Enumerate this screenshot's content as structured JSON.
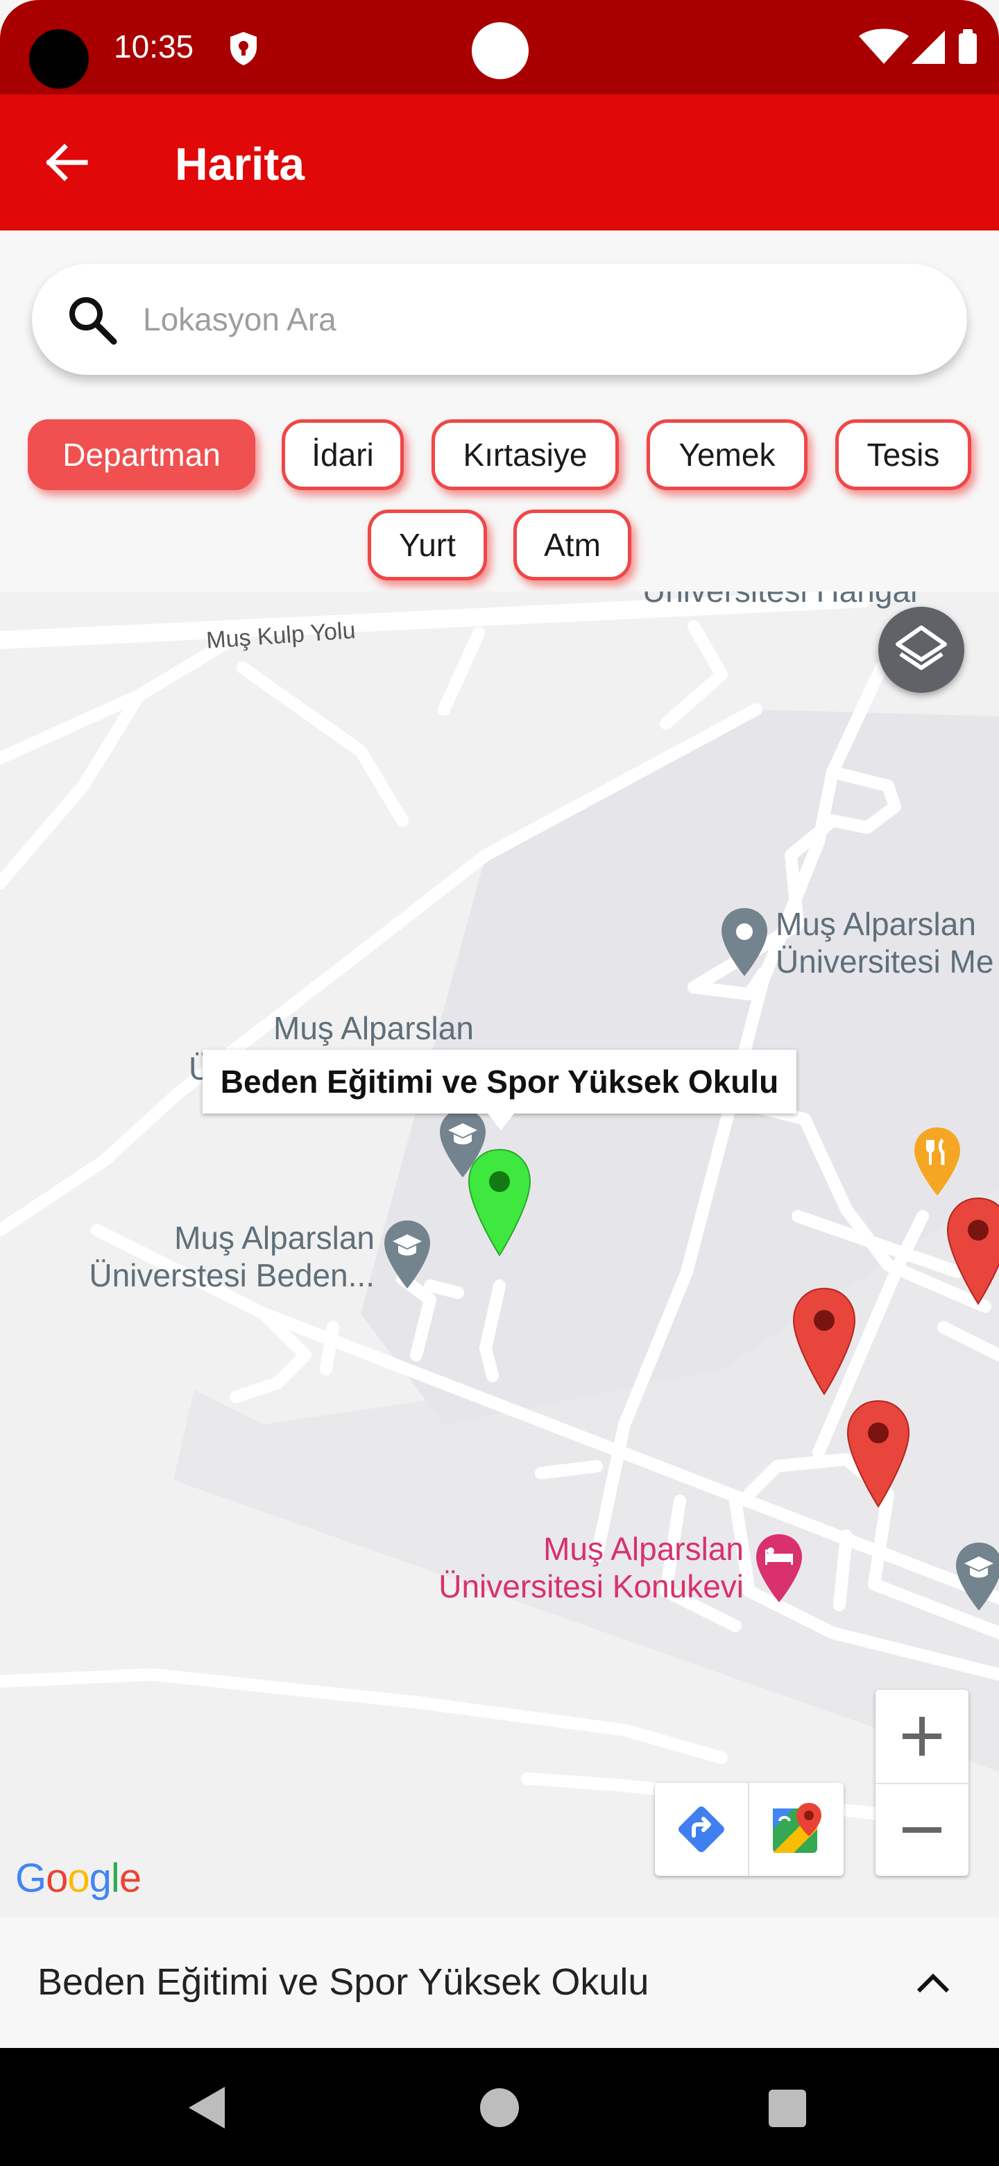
{
  "status_bar": {
    "time": "10:35"
  },
  "app_bar": {
    "title": "Harita"
  },
  "search": {
    "placeholder": "Lokasyon Ara",
    "value": ""
  },
  "filters": [
    {
      "label": "Departman",
      "selected": true
    },
    {
      "label": "İdari",
      "selected": false
    },
    {
      "label": "Kırtasiye",
      "selected": false
    },
    {
      "label": "Yemek",
      "selected": false
    },
    {
      "label": "Tesis",
      "selected": false
    },
    {
      "label": "Yurt",
      "selected": false
    },
    {
      "label": "Atm",
      "selected": false
    }
  ],
  "map": {
    "road_label": "Muş Kulp Yolu",
    "labels": {
      "hangar": "Üniversitesi Hangar",
      "med_line1": "Muş Alparslan",
      "med_line2": "Üniversitesi Me",
      "alparslan_top": "Muş Alparslan",
      "alparslan_partial": "Ü",
      "beden_line1": "Muş Alparslan",
      "beden_line2": "Üniverstesi Beden...",
      "konukevi_line1": "Muş Alparslan",
      "konukevi_line2": "Üniversitesi Konukevi"
    },
    "info_window": "Beden Eğitimi ve Spor Yüksek Okulu",
    "google_logo": "Google"
  },
  "bottom_sheet": {
    "title": "Beden Eğitimi ve Spor Yüksek Okulu"
  },
  "colors": {
    "status_bar": "#a80000",
    "app_bar": "#e00808",
    "chip_accent": "#ef4747",
    "selected_pin": "#3ee83e",
    "marker_red": "#e8453c",
    "poi_gray": "#73848f",
    "poi_pink": "#d9316c",
    "poi_orange": "#f5a623"
  }
}
